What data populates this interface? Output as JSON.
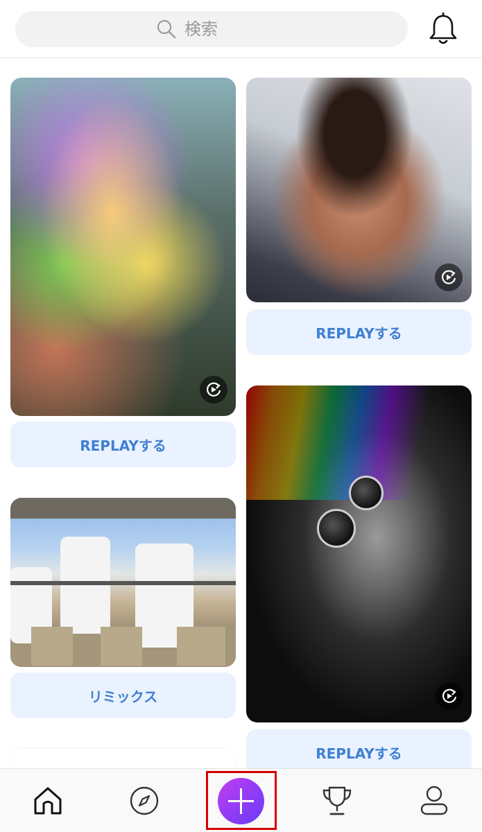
{
  "header": {
    "search_placeholder": "検索"
  },
  "feed": {
    "cards": [
      {
        "button_label": "REPLAYする"
      },
      {
        "button_label": "REPLAYする"
      },
      {
        "button_label": "リミックス"
      },
      {
        "button_label": "REPLAYする"
      }
    ]
  },
  "bottom_nav": {
    "items": [
      "home-icon",
      "compass-icon",
      "create-plus-icon",
      "trophy-icon",
      "profile-icon"
    ]
  },
  "colors": {
    "accent_button_bg": "#e9f2fe",
    "accent_button_text": "#3f7fd3",
    "create_gradient_start": "#c33cf0",
    "create_gradient_end": "#6a3df6",
    "highlight_frame": "#d40000"
  }
}
